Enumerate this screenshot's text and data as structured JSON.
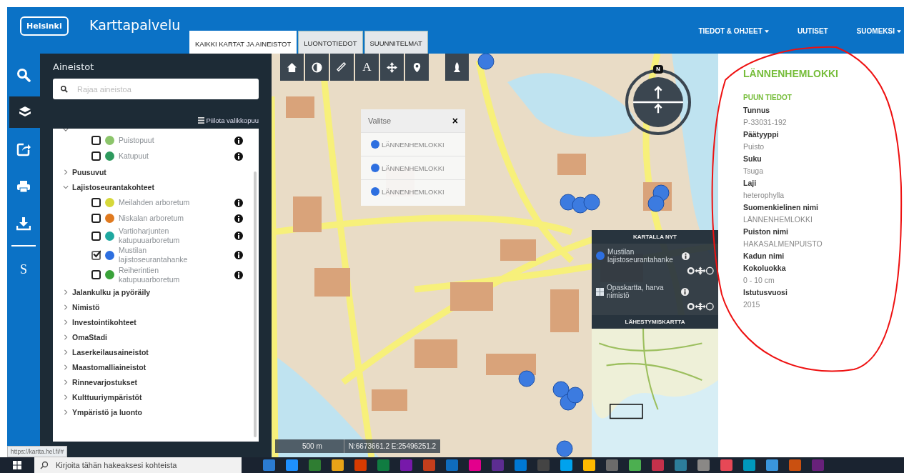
{
  "header": {
    "logo": "Helsinki",
    "title": "Karttapalvelu",
    "tabs": [
      {
        "label": "KAIKKI KARTAT JA AINEISTOT",
        "selected": true
      },
      {
        "label": "LUONTOTIEDOT",
        "selected": false
      },
      {
        "label": "SUUNNITELMAT",
        "selected": false
      }
    ],
    "nav": [
      {
        "label": "TIEDOT & OHJEET",
        "dropdown": true
      },
      {
        "label": "UUTISET",
        "dropdown": false
      },
      {
        "label": "SUOMEKSI",
        "dropdown": true
      }
    ]
  },
  "rail": [
    {
      "kind": "search",
      "selected": false
    },
    {
      "kind": "layers",
      "selected": true
    },
    {
      "kind": "share",
      "selected": false
    },
    {
      "kind": "print",
      "selected": false
    },
    {
      "kind": "download",
      "selected": false
    },
    {
      "kind": "divider"
    },
    {
      "kind": "text",
      "label": "S",
      "selected": false
    }
  ],
  "layers_panel": {
    "title": "Aineistot",
    "search": {
      "placeholder": "Rajaa aineistoa"
    },
    "hide_link": "Piilota valikkopuu",
    "tree": [
      {
        "kind": "group",
        "expanded": true,
        "children": [
          {
            "kind": "layer",
            "label": "Puistopuut",
            "checked": false,
            "color": "#8cc56b"
          },
          {
            "kind": "layer",
            "label": "Katupuut",
            "checked": false,
            "color": "#2e9a5e"
          }
        ]
      },
      {
        "kind": "group",
        "label": "Puusuvut",
        "expanded": false
      },
      {
        "kind": "group",
        "label": "Lajistoseurantakohteet",
        "expanded": true,
        "children": [
          {
            "kind": "layer",
            "label": "Meilahden arboretum",
            "checked": false,
            "color": "#d6d83a"
          },
          {
            "kind": "layer",
            "label": "Niskalan arboretum",
            "checked": false,
            "color": "#e07a1f"
          },
          {
            "kind": "layer",
            "label": "Vartioharjunten katupuuarboretum",
            "checked": false,
            "color": "#1fa8a0"
          },
          {
            "kind": "layer",
            "label": "Mustilan lajistoseurantahanke",
            "checked": true,
            "color": "#2d6fe0"
          },
          {
            "kind": "layer",
            "label": "Reiherintien katupuuarboretum",
            "checked": false,
            "color": "#3aa33a"
          }
        ]
      },
      {
        "kind": "group",
        "label": "Jalankulku ja pyöräily",
        "expanded": false
      },
      {
        "kind": "group",
        "label": "Nimistö",
        "expanded": false
      },
      {
        "kind": "group",
        "label": "Investointikohteet",
        "expanded": false
      },
      {
        "kind": "group",
        "label": "OmaStadi",
        "expanded": false
      },
      {
        "kind": "group",
        "label": "Laserkeilausaineistot",
        "expanded": false
      },
      {
        "kind": "group",
        "label": "Maastomalliaineistot",
        "expanded": false
      },
      {
        "kind": "group",
        "label": "Rinnevarjostukset",
        "expanded": false
      },
      {
        "kind": "group",
        "label": "Kulttuuriympäristöt",
        "expanded": false
      },
      {
        "kind": "group",
        "label": "Ympäristö ja luonto",
        "expanded": false
      }
    ]
  },
  "map": {
    "tools": [
      {
        "kind": "home"
      },
      {
        "kind": "contrast"
      },
      {
        "kind": "ruler"
      },
      {
        "kind": "text",
        "label": "A"
      },
      {
        "kind": "crosshair"
      },
      {
        "kind": "pin"
      },
      {
        "kind": "rocket"
      }
    ],
    "compass": {
      "label": "N"
    },
    "popup": {
      "title": "Valitse",
      "close": "×",
      "items": [
        {
          "label": "LÄNNENHEMLOKKI",
          "color": "#2d6fe0"
        },
        {
          "label": "LÄNNENHEMLOKKI",
          "color": "#2d6fe0"
        },
        {
          "label": "LÄNNENHEMLOKKI",
          "color": "#2d6fe0"
        }
      ]
    },
    "layers_on_map": {
      "title": "KARTALLA NYT",
      "items": [
        {
          "kind": "point",
          "label": "Mustilan lajistoseurantahanke",
          "color": "#2d6fe0"
        },
        {
          "kind": "basemap",
          "label": "Opaskartta, harva nimistö"
        }
      ]
    },
    "overview": {
      "title": "LÄHESTYMISKARTTA"
    },
    "scale": "500 m",
    "coordinates": "N:6673661.2 E:25496251.2"
  },
  "info_panel": {
    "title": "LÄNNENHEMLOKKI",
    "section": "PUUN TIEDOT",
    "fields": [
      {
        "label": "Tunnus",
        "value": "P-33031-192"
      },
      {
        "label": "Päätyyppi",
        "value": "Puisto"
      },
      {
        "label": "Suku",
        "value": "Tsuga"
      },
      {
        "label": "Laji",
        "value": "heterophylla"
      },
      {
        "label": "Suomenkielinen nimi",
        "value": "LÄNNENHEMLOKKI"
      },
      {
        "label": "Puiston nimi",
        "value": "HAKASALMENPUISTO"
      },
      {
        "label": "Kadun nimi"
      },
      {
        "label": "Kokoluokka",
        "value": "0 - 10 cm"
      },
      {
        "label": "Istutusvuosi",
        "value": "2015"
      }
    ]
  },
  "status_url": "https://kartta.hel.fi/#",
  "taskbar": {
    "search": {
      "placeholder": "Kirjoita tähän hakeaksesi kohteista"
    }
  }
}
